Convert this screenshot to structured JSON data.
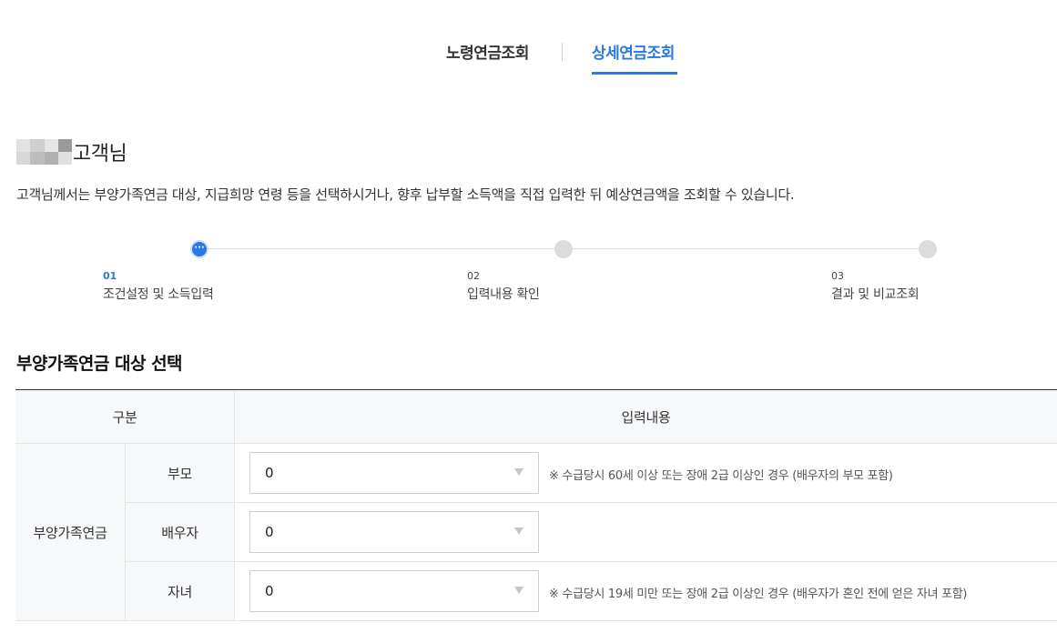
{
  "tabs": [
    {
      "label": "노령연금조회",
      "active": false
    },
    {
      "label": "상세연금조회",
      "active": true
    }
  ],
  "customer": {
    "suffix": "고객님",
    "intro": "고객님께서는 부양가족연금 대상, 지급희망 연령 등을 선택하시거나, 향후 납부할 소득액을 직접 입력한 뒤 예상연금액을 조회할 수 있습니다."
  },
  "steps": [
    {
      "num": "01",
      "label": "조건설정 및 소득입력",
      "active": true
    },
    {
      "num": "02",
      "label": "입력내용 확인",
      "active": false
    },
    {
      "num": "03",
      "label": "결과 및 비교조회",
      "active": false
    }
  ],
  "section": {
    "title": "부양가족연금 대상 선택"
  },
  "table": {
    "header_category": "구분",
    "header_input": "입력내용",
    "group_label": "부양가족연금",
    "rows": [
      {
        "label": "부모",
        "value": "0",
        "note": "※ 수급당시 60세 이상 또는 장애 2급 이상인 경우 (배우자의 부모 포함)"
      },
      {
        "label": "배우자",
        "value": "0",
        "note": ""
      },
      {
        "label": "자녀",
        "value": "0",
        "note": "※ 수급당시 19세 미만 또는 장애 2급 이상인 경우 (배우자가 혼인 전에 얻은 자녀 포함)"
      }
    ]
  },
  "colors": {
    "accent": "#2b78e4",
    "inactive_dot": "#dcdcdc",
    "header_bg": "#f7f8fa"
  }
}
